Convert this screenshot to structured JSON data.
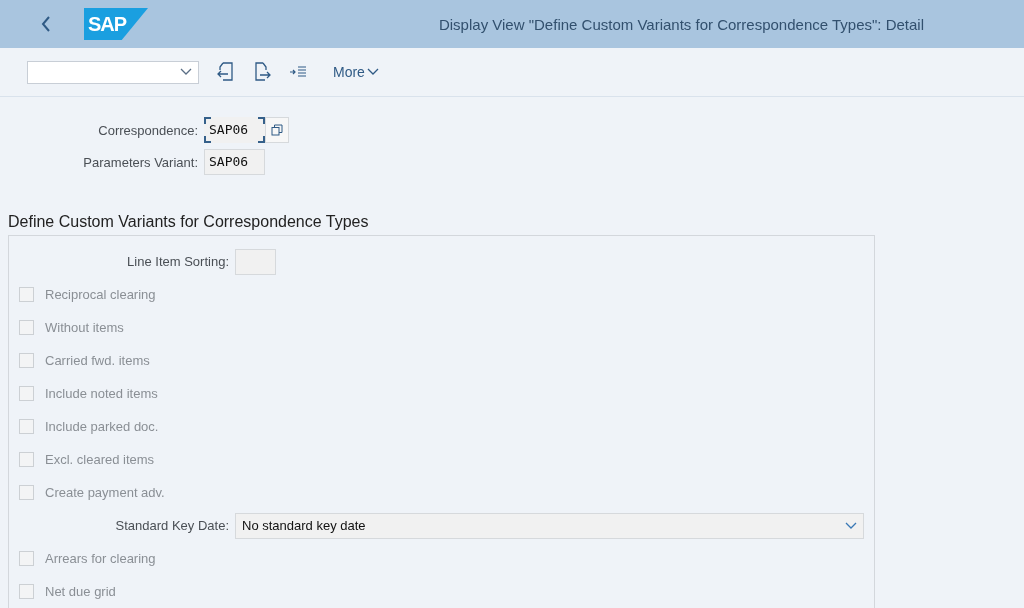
{
  "header": {
    "logo": "SAP",
    "title": "Display View \"Define Custom Variants for Correspondence Types\": Detail"
  },
  "toolbar": {
    "more": "More"
  },
  "fields": [
    {
      "label": "Correspondence:",
      "value": "SAP06",
      "focused": true
    },
    {
      "label": "Parameters Variant:",
      "value": "SAP06",
      "focused": false
    }
  ],
  "group": {
    "title": "Define Custom Variants for Correspondence Types",
    "items": [
      {
        "kind": "field",
        "label": "Line Item Sorting:"
      },
      {
        "kind": "checkbox",
        "label": "Reciprocal clearing",
        "checked": false,
        "disabled": true
      },
      {
        "kind": "checkbox",
        "label": "Without items",
        "checked": false,
        "disabled": true
      },
      {
        "kind": "checkbox",
        "label": "Carried fwd. items",
        "checked": false,
        "disabled": true
      },
      {
        "kind": "checkbox",
        "label": "Include noted items",
        "checked": false,
        "disabled": true
      },
      {
        "kind": "checkbox",
        "label": "Include parked doc.",
        "checked": false,
        "disabled": true
      },
      {
        "kind": "checkbox",
        "label": "Excl. cleared items",
        "checked": false,
        "disabled": true
      },
      {
        "kind": "checkbox",
        "label": "Create payment adv.",
        "checked": false,
        "disabled": true
      },
      {
        "kind": "dropdown",
        "label": "Standard Key Date:",
        "value": "No standard key date"
      },
      {
        "kind": "checkbox",
        "label": "Arrears for clearing",
        "checked": false,
        "disabled": true
      },
      {
        "kind": "checkbox",
        "label": "Net due grid",
        "checked": false,
        "disabled": true
      }
    ]
  }
}
